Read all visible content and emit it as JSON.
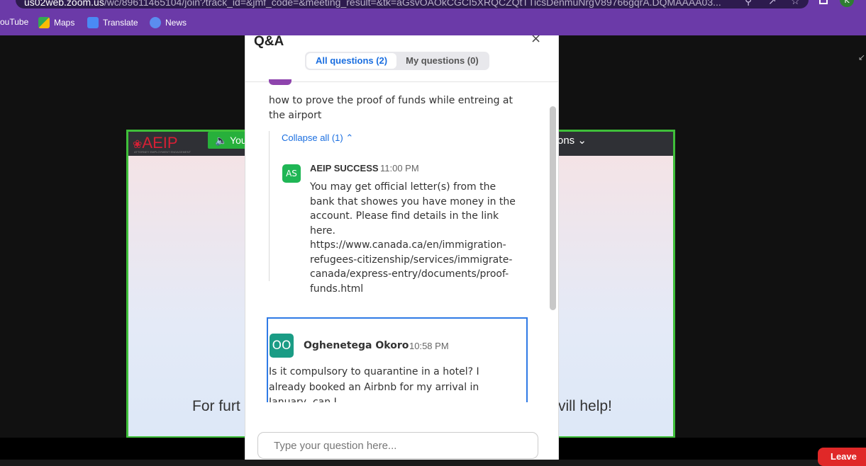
{
  "browser": {
    "url_host": "us02web.zoom.us",
    "url_path": "/wc/89611465104/join?track_id=&jmf_code=&meeting_result=&tk=aGsvOAOkCGCI5XRQCZQtTTicsDenmuNrgV89766gqrA.DQMAAAA03...",
    "profile_initial": "K",
    "bookmarks": [
      {
        "label": "ouTube",
        "icon": "youtube-icon"
      },
      {
        "label": "Maps",
        "icon": "maps-icon"
      },
      {
        "label": "Translate",
        "icon": "translate-icon"
      },
      {
        "label": "News",
        "icon": "news-icon"
      }
    ]
  },
  "meeting": {
    "leave_label": "Leave",
    "share": {
      "logo_text": "AEIP",
      "logo_subtitle": "ATTORNEY EMPLOYMENT ENGAGEMENT",
      "speaking_label": "You",
      "view_options_label": "ons",
      "caption_left": "For furt",
      "caption_right": "vill help!"
    }
  },
  "qa": {
    "title": "Q&A",
    "tabs": [
      {
        "label": "All questions (2)",
        "active": true
      },
      {
        "label": "My questions (0)",
        "active": false
      }
    ],
    "question1": {
      "text": "how to prove the proof of funds while entreing at the airport",
      "collapse_label": "Collapse all (1)",
      "answer": {
        "initials": "AS",
        "name": "AEIP SUCCESS",
        "time": "11:00 PM",
        "text": "You may get official letter(s) from the bank that showes you have money in the account. Please find details in the link here. https://www.canada.ca/en/immigration-refugees-citizenship/services/immigrate-canada/express-entry/documents/proof-funds.html"
      }
    },
    "question2": {
      "initials": "OO",
      "name": "Oghenetega Okoro",
      "time": "10:58 PM",
      "text": "Is it compulsory to quarantine in a hotel? I already booked an Airbnb for my arrival in January, can I"
    },
    "input_placeholder": "Type your question here..."
  },
  "colors": {
    "browser_chrome": "#6b3aa8",
    "share_border": "#3fbf3a",
    "accent_blue": "#1a6ee0",
    "leave_red": "#e02828",
    "avatar_as": "#1fb655",
    "avatar_oo": "#1a9c85"
  }
}
